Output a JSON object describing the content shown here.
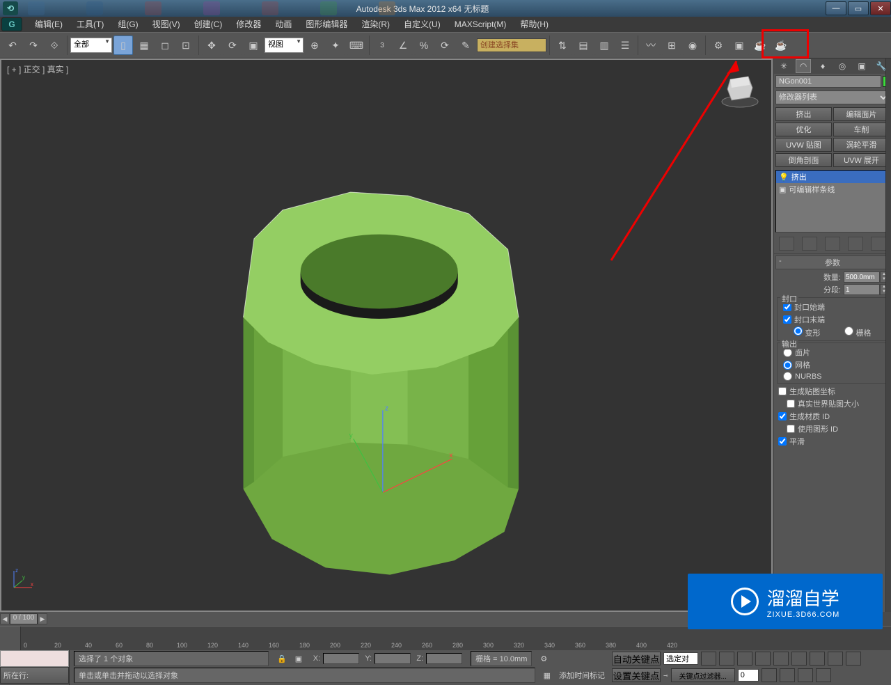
{
  "title": "Autodesk 3ds Max  2012 x64       无标题",
  "menu": {
    "edit": "编辑(E)",
    "tools": "工具(T)",
    "group": "组(G)",
    "view": "视图(V)",
    "create": "创建(C)",
    "modifiers": "修改器",
    "animation": "动画",
    "grapheditors": "图形编辑器",
    "rendering": "渲染(R)",
    "customize": "自定义(U)",
    "maxscript": "MAXScript(M)",
    "help": "帮助(H)"
  },
  "toolbar": {
    "category": "全部",
    "viewmode": "视图",
    "selectionset": "创建选择集"
  },
  "viewport": {
    "label": "[ + ] 正交 ] 真实 ]"
  },
  "panel": {
    "objectName": "NGon001",
    "modifierList": "修改器列表",
    "btns": {
      "extrude": "挤出",
      "editface": "编辑面片",
      "optimize": "优化",
      "lathe": "车削",
      "uvwmap": "UVW 贴图",
      "turbosmooth": "涡轮平滑",
      "chamfer": "倒角剖面",
      "uvwunwrap": "UVW 展开"
    },
    "stack": {
      "extrude": "挤出",
      "spline": "可编辑样条线"
    },
    "rollup": "参数",
    "amount_lbl": "数量:",
    "amount": "500.0mm",
    "segments_lbl": "分段:",
    "segments": "1",
    "capping": "封口",
    "cap_start": "封口始端",
    "cap_end": "封口末端",
    "morph": "变形",
    "grid": "栅格",
    "output": "输出",
    "patch": "面片",
    "mesh": "网格",
    "nurbs": "NURBS",
    "genmapcoord": "生成贴图坐标",
    "realworld": "真实世界贴图大小",
    "genmatid": "生成材质 ID",
    "useshapeid": "使用图形 ID",
    "smooth": "平滑"
  },
  "timeline": {
    "frame": "0 / 100"
  },
  "status": {
    "now": "所在行:",
    "selection": "选择了 1 个对象",
    "prompt": "单击或单击并拖动以选择对象",
    "grid": "栅格 = 10.0mm",
    "addtimetag": "添加时间标记",
    "autokey": "自动关键点",
    "selected": "选定对",
    "setkey": "设置关键点",
    "keyfilter": "关键点过滤器..."
  },
  "watermark": {
    "brand": "溜溜自学",
    "url": "ZIXUE.3D66.COM"
  },
  "ticks": [
    "0",
    "20",
    "40",
    "60",
    "80",
    "100",
    "120",
    "140",
    "160",
    "180",
    "200",
    "220",
    "240",
    "260",
    "280",
    "300",
    "320",
    "340",
    "360",
    "380",
    "400",
    "420"
  ]
}
